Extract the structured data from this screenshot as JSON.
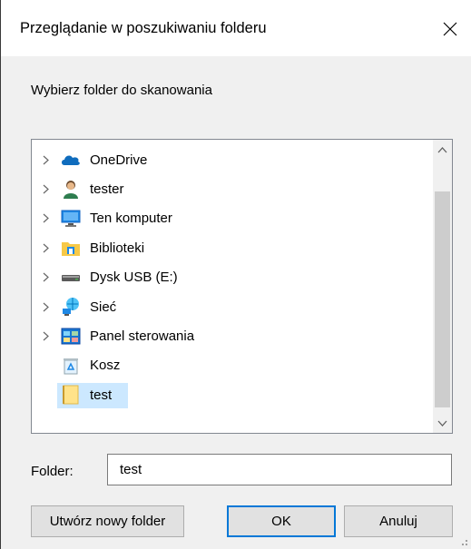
{
  "dialog": {
    "title": "Przeglądanie w poszukiwaniu folderu",
    "instruction": "Wybierz folder do skanowania"
  },
  "tree": {
    "items": [
      {
        "label": "OneDrive",
        "icon": "onedrive-cloud-icon",
        "expandable": true
      },
      {
        "label": "tester",
        "icon": "user-icon",
        "expandable": true
      },
      {
        "label": "Ten komputer",
        "icon": "computer-icon",
        "expandable": true
      },
      {
        "label": "Biblioteki",
        "icon": "libraries-icon",
        "expandable": true
      },
      {
        "label": "Dysk USB (E:)",
        "icon": "usb-drive-icon",
        "expandable": true
      },
      {
        "label": "Sieć",
        "icon": "network-icon",
        "expandable": true
      },
      {
        "label": "Panel sterowania",
        "icon": "control-panel-icon",
        "expandable": true
      },
      {
        "label": "Kosz",
        "icon": "recycle-bin-icon",
        "expandable": false
      },
      {
        "label": "test",
        "icon": "folder-icon",
        "expandable": false,
        "selected": true
      }
    ]
  },
  "folder_field": {
    "label": "Folder:",
    "value": "test"
  },
  "buttons": {
    "new_folder": "Utwórz nowy folder",
    "ok": "OK",
    "cancel": "Anuluj"
  },
  "colors": {
    "accent": "#0078d7",
    "selection": "#cce8ff"
  }
}
